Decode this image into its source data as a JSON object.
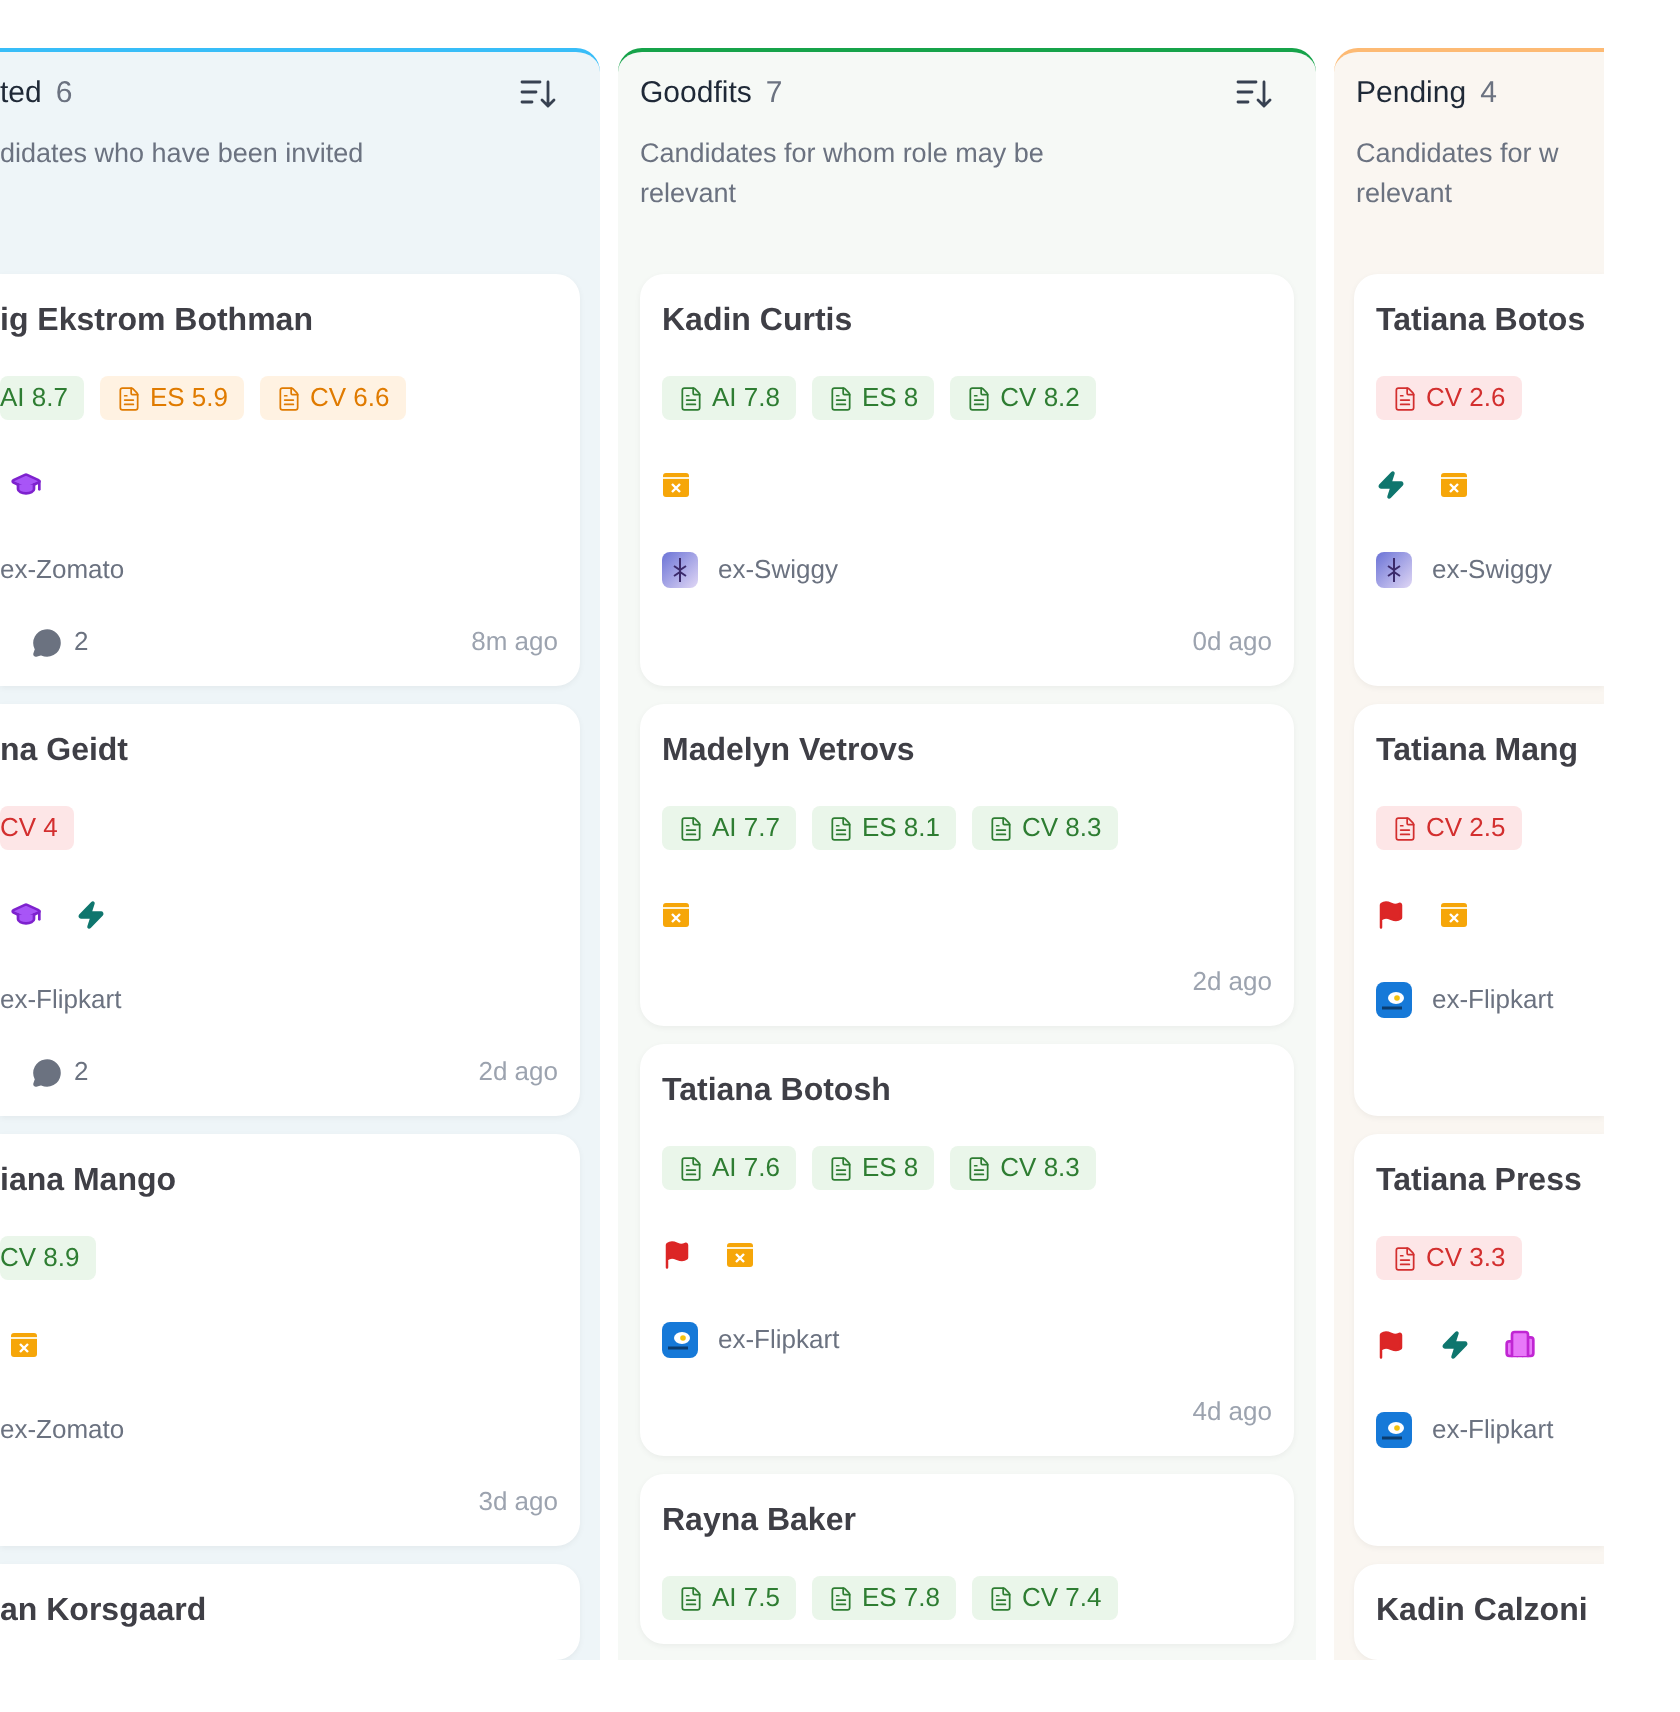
{
  "columns": [
    {
      "title": "ted",
      "count": "6",
      "color": "#38bdf8",
      "kind": "left",
      "description_lines": [
        "didates who have been invited"
      ],
      "cards": [
        {
          "name": "ig Ekstrom Bothman",
          "scores": [
            {
              "text": "AI 8.7",
              "kind": "good",
              "icon": false
            },
            {
              "text": "ES 5.9",
              "kind": "warn",
              "icon": true
            },
            {
              "text": "CV 6.6",
              "kind": "warn",
              "icon": true
            }
          ],
          "markers": [
            {
              "kind": "education"
            }
          ],
          "company": {
            "name": "ex-Zomato"
          },
          "comments": "2",
          "time": "8m ago"
        },
        {
          "name": "na Geidt",
          "scores": [
            {
              "text": "CV 4",
              "kind": "bad",
              "icon": false
            }
          ],
          "markers": [
            {
              "kind": "education"
            },
            {
              "kind": "bolt"
            }
          ],
          "company": {
            "name": "ex-Flipkart"
          },
          "comments": "2",
          "time": "2d ago"
        },
        {
          "name": "iana Mango",
          "scores": [
            {
              "text": "CV 8.9",
              "kind": "good",
              "icon": false
            }
          ],
          "markers": [
            {
              "kind": "calendar"
            }
          ],
          "company": {
            "name": "ex-Zomato"
          },
          "time": "3d ago"
        },
        {
          "name": "an Korsgaard"
        }
      ]
    },
    {
      "title": "Goodfits",
      "count": "7",
      "color": "#16a34a",
      "kind": "full",
      "description_lines": [
        "Candidates for whom role may be",
        "relevant"
      ],
      "cards": [
        {
          "name": "Kadin Curtis",
          "scores": [
            {
              "text": "AI 7.8",
              "kind": "good",
              "icon": true
            },
            {
              "text": "ES 8",
              "kind": "good",
              "icon": true
            },
            {
              "text": "CV 8.2",
              "kind": "good",
              "icon": true
            }
          ],
          "markers": [
            {
              "kind": "calendar"
            }
          ],
          "company": {
            "name": "ex-Swiggy",
            "logo": {
              "kind": "violet"
            }
          },
          "time": "0d ago"
        },
        {
          "name": "Madelyn Vetrovs",
          "scores": [
            {
              "text": "AI 7.7",
              "kind": "good",
              "icon": true
            },
            {
              "text": "ES 8.1",
              "kind": "good",
              "icon": true
            },
            {
              "text": "CV 8.3",
              "kind": "good",
              "icon": true
            }
          ],
          "markers": [
            {
              "kind": "calendar"
            }
          ],
          "time": "2d ago"
        },
        {
          "name": "Tatiana Botosh",
          "scores": [
            {
              "text": "AI 7.6",
              "kind": "good",
              "icon": true
            },
            {
              "text": "ES 8",
              "kind": "good",
              "icon": true
            },
            {
              "text": "CV 8.3",
              "kind": "good",
              "icon": true
            }
          ],
          "markers": [
            {
              "kind": "flag"
            },
            {
              "kind": "calendar"
            }
          ],
          "company": {
            "name": "ex-Flipkart",
            "logo": {
              "kind": "blue"
            }
          },
          "time": "4d ago"
        },
        {
          "name": "Rayna Baker",
          "scores": [
            {
              "text": "AI 7.5",
              "kind": "good",
              "icon": true
            },
            {
              "text": "ES 7.8",
              "kind": "good",
              "icon": true
            },
            {
              "text": "CV 7.4",
              "kind": "good",
              "icon": true
            }
          ]
        }
      ]
    },
    {
      "title": "Pending",
      "count": "4",
      "color": "#fdba74",
      "kind": "right",
      "description_lines": [
        "Candidates for w",
        "relevant"
      ],
      "cards": [
        {
          "name": "Tatiana Botos",
          "scores": [
            {
              "text": "CV 2.6",
              "kind": "bad",
              "icon": true
            }
          ],
          "markers": [
            {
              "kind": "bolt"
            },
            {
              "kind": "calendar"
            }
          ],
          "company": {
            "name": "ex-Swiggy",
            "logo": {
              "kind": "violet"
            }
          }
        },
        {
          "name": "Tatiana Mang",
          "scores": [
            {
              "text": "CV 2.5",
              "kind": "bad",
              "icon": true
            }
          ],
          "markers": [
            {
              "kind": "flag"
            },
            {
              "kind": "calendar"
            }
          ],
          "company": {
            "name": "ex-Flipkart",
            "logo": {
              "kind": "blue"
            }
          }
        },
        {
          "name": "Tatiana Press",
          "scores": [
            {
              "text": "CV 3.3",
              "kind": "bad",
              "icon": true
            }
          ],
          "markers": [
            {
              "kind": "flag"
            },
            {
              "kind": "bolt"
            },
            {
              "kind": "building"
            }
          ],
          "company": {
            "name": "ex-Flipkart",
            "logo": {
              "kind": "blue"
            }
          }
        },
        {
          "name": "Kadin Calzoni"
        }
      ]
    }
  ]
}
